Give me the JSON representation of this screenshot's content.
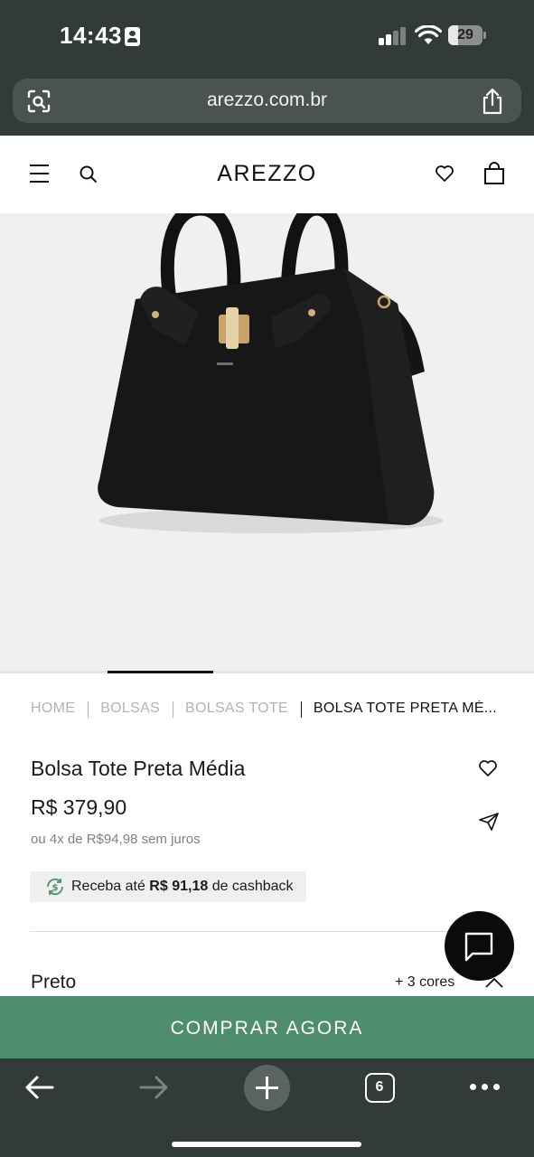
{
  "status_bar": {
    "time": "14:43",
    "battery": "29",
    "battery_level": 0.29
  },
  "browser": {
    "url": "arezzo.com.br",
    "open_tabs": "6"
  },
  "header": {
    "brand": "AREZZO"
  },
  "breadcrumb": [
    {
      "label": "HOME"
    },
    {
      "label": "BOLSAS"
    },
    {
      "label": "BOLSAS TOTE"
    },
    {
      "label": "BOLSA TOTE PRETA MÉ..."
    }
  ],
  "product": {
    "title": "Bolsa Tote Preta Média",
    "price": "R$ 379,90",
    "installments": "ou 4x de R$94,98 sem juros",
    "cashback": {
      "prefix": "Receba até",
      "amount": "R$ 91,18",
      "suffix": "de cashback"
    },
    "color": "Preto",
    "more_colors": "+ 3 cores"
  },
  "cta": {
    "buy_label": "COMPRAR AGORA"
  },
  "colors": {
    "chrome": "#333a3a",
    "buy_button": "#4f8e6d",
    "cashback_bg": "#efefef"
  }
}
